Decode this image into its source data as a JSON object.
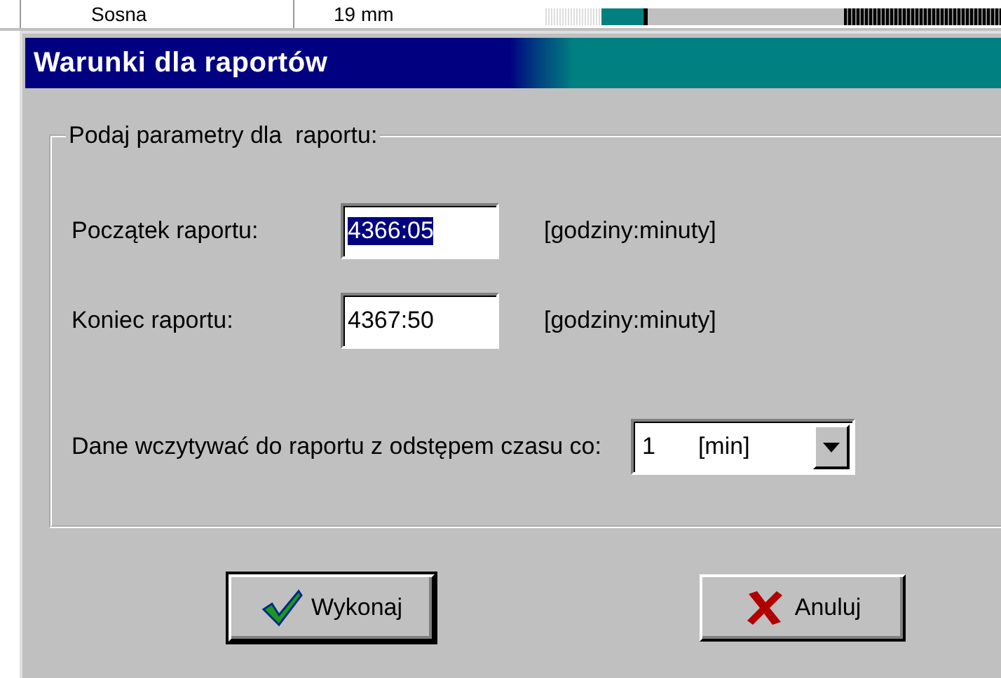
{
  "background_row": {
    "name": "Sosna",
    "size": "19 mm"
  },
  "window": {
    "title": "Warunki dla raportów"
  },
  "group": {
    "legend": "Podaj parametry dla  raportu:",
    "fields": [
      {
        "label": "Początek raportu:",
        "value": "4366:05",
        "highlighted": true,
        "hint": "[godziny:minuty]"
      },
      {
        "label": "Koniec raportu:",
        "value": "4367:50",
        "highlighted": false,
        "hint": "[godziny:minuty]"
      }
    ],
    "interval": {
      "label": "Dane wczytywać do raportu z odstępem czasu co:",
      "value": "1",
      "unit": "[min]"
    }
  },
  "buttons": [
    {
      "kind": "ok",
      "label": "Wykonaj"
    },
    {
      "kind": "cancel",
      "label": "Anuluj"
    }
  ]
}
